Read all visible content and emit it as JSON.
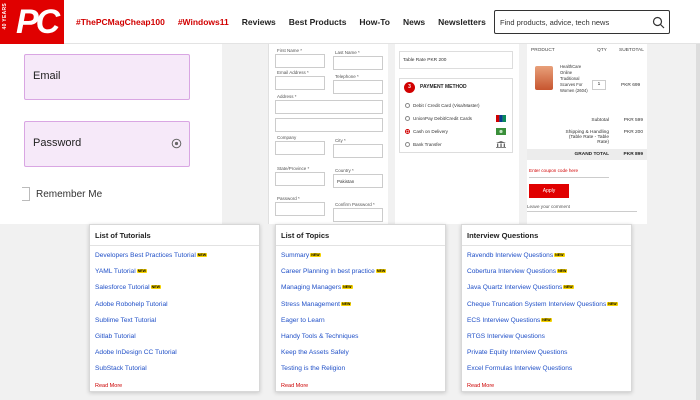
{
  "header": {
    "logo": {
      "text": "PC",
      "years": "40 YEARS"
    },
    "nav": [
      {
        "label": "#ThePCMagCheap100",
        "highlight": true
      },
      {
        "label": "#Windows11",
        "highlight": true
      },
      {
        "label": "Reviews",
        "highlight": false
      },
      {
        "label": "Best Products",
        "highlight": false
      },
      {
        "label": "How-To",
        "highlight": false
      },
      {
        "label": "News",
        "highlight": false
      },
      {
        "label": "Newsletters",
        "highlight": false
      }
    ],
    "search": {
      "placeholder": "Find products, advice, tech news",
      "icon": "search-icon"
    }
  },
  "login": {
    "email_label": "Email",
    "password_label": "Password",
    "remember_label": "Remember Me"
  },
  "checkout_form": {
    "first_name": "First Name *",
    "last_name": "Last Name *",
    "email": "Email Address *",
    "telephone": "Telephone *",
    "address": "Address *",
    "company": "Company",
    "city": "City *",
    "state": "State/Province *",
    "country_label": "Country *",
    "country_value": "Pakistan",
    "password": "Password *",
    "confirm_password": "Confirm Password *"
  },
  "payment": {
    "table_rate": "Table Rate PKR 200",
    "number": "3",
    "title": "PAYMENT METHOD",
    "options": [
      {
        "label": "Debit / Credit Card (Visa/Master)",
        "selected": false
      },
      {
        "label": "UnionPay Debit/Credit Cards",
        "selected": false
      },
      {
        "label": "Cash on Delivery",
        "selected": true
      },
      {
        "label": "Bank Transfer",
        "selected": false
      }
    ]
  },
  "order": {
    "columns": {
      "product": "PRODUCT",
      "qty": "QTY",
      "subtotal": "SUBTOTAL"
    },
    "item": {
      "name": "HealthCare Online Traditional Scarves For Women (2604)",
      "qty": "1",
      "price": "PKR 699"
    },
    "subtotal_label": "Subtotal",
    "subtotal_value": "PKR 599",
    "shipping_label": "Shipping & Handling (Table Rate - Table Rate)",
    "shipping_value": "PKR 200",
    "grand_label": "GRAND TOTAL",
    "grand_value": "PKR 899",
    "coupon_placeholder": "Enter coupon code here",
    "apply_label": "Apply",
    "comment_placeholder": "Leave your comment"
  },
  "cards": [
    {
      "title": "List of Tutorials",
      "items": [
        {
          "text": "Developers Best Practices Tutorial",
          "new": true
        },
        {
          "text": "YAML Tutorial",
          "new": true
        },
        {
          "text": "Salesforce Tutorial",
          "new": true
        },
        {
          "text": "Adobe Robohelp Tutorial",
          "new": false
        },
        {
          "text": "Sublime Text Tutorial",
          "new": false
        },
        {
          "text": "Gitlab Tutorial",
          "new": false
        },
        {
          "text": "Adobe InDesign CC Tutorial",
          "new": false
        },
        {
          "text": "SubStack Tutorial",
          "new": false
        }
      ],
      "read_more": "Read More"
    },
    {
      "title": "List of Topics",
      "items": [
        {
          "text": "Summary",
          "new": true
        },
        {
          "text": "Career Planning in best practice",
          "new": true
        },
        {
          "text": "Managing Managers",
          "new": true
        },
        {
          "text": "Stress Management",
          "new": true
        },
        {
          "text": "Eager to Learn",
          "new": false
        },
        {
          "text": "Handy Tools & Techniques",
          "new": false
        },
        {
          "text": "Keep the Assets Safely",
          "new": false
        },
        {
          "text": "Testing is the Religion",
          "new": false
        }
      ],
      "read_more": "Read More"
    },
    {
      "title": "Interview Questions",
      "items": [
        {
          "text": "Ravendb Interview Questions",
          "new": true
        },
        {
          "text": "Cobertura Interview Questions",
          "new": true
        },
        {
          "text": "Java Quartz Interview Questions",
          "new": true
        },
        {
          "text": "Cheque Truncation System Interview Questions",
          "new": true
        },
        {
          "text": "ECS Interview Questions",
          "new": true
        },
        {
          "text": "RTGS Interview Questions",
          "new": false
        },
        {
          "text": "Private Equity Interview Questions",
          "new": false
        },
        {
          "text": "Excel Formulas Interview Questions",
          "new": false
        }
      ],
      "read_more": "Read More"
    }
  ],
  "new_badge": "NEW"
}
